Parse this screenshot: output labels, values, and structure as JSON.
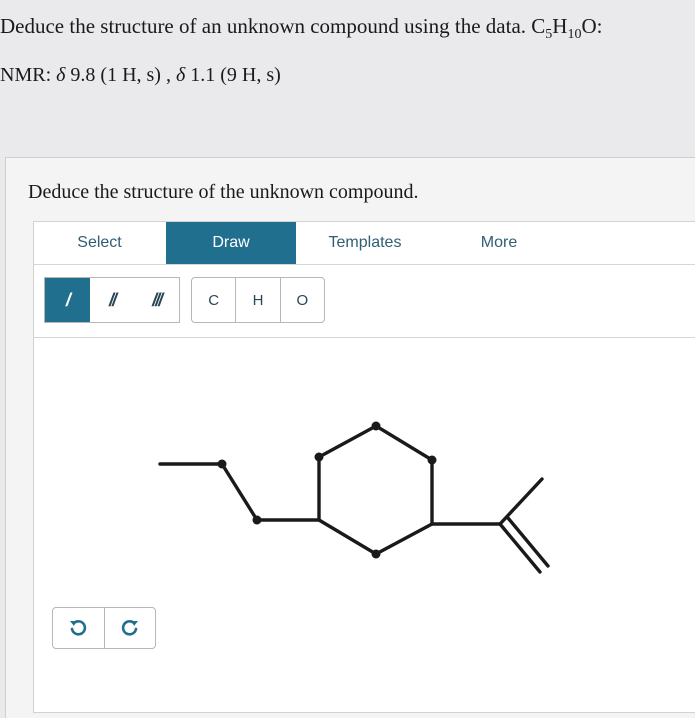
{
  "question": {
    "text_before": "Deduce the structure of an unknown compound using the data. C",
    "sub_c": "5",
    "h": "H",
    "sub_h": "10",
    "text_after": "O:"
  },
  "nmr": {
    "prefix": "NMR: ",
    "delta": "δ",
    "signal1": " 9.8  (1 H, s) , ",
    "signal2": " 1.1  (9 H, s)"
  },
  "prompt": "Deduce the structure of the unknown compound.",
  "tabs": [
    {
      "label": "Select"
    },
    {
      "label": "Draw"
    },
    {
      "label": "Templates"
    },
    {
      "label": "More"
    }
  ],
  "active_tab": "Draw",
  "bond_buttons": [
    {
      "label": "/",
      "name": "single-bond"
    },
    {
      "label": "//",
      "name": "double-bond"
    },
    {
      "label": "///",
      "name": "triple-bond"
    }
  ],
  "atom_buttons": [
    {
      "label": "C"
    },
    {
      "label": "H"
    },
    {
      "label": "O"
    }
  ],
  "icons": {
    "undo": "undo-icon",
    "redo": "redo-icon"
  },
  "colors": {
    "accent": "#216f8e",
    "tab_text": "#2f5f73"
  }
}
